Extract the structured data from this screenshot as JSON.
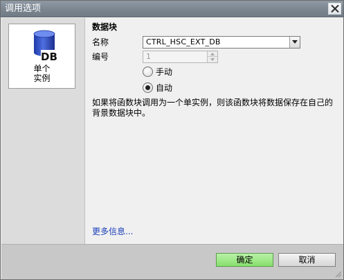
{
  "window": {
    "title": "调用选项"
  },
  "left_panel": {
    "tile_label_line1": "单个",
    "tile_label_line2": "实例",
    "icon_text": "DB"
  },
  "main": {
    "section_title": "数据块",
    "name_label": "名称",
    "name_value": "CTRL_HSC_EXT_DB",
    "number_label": "编号",
    "number_value": "1",
    "radio_manual": "手动",
    "radio_auto": "自动",
    "selected_numbering": "自动",
    "description": "如果将函数块调用为一个单实例，则该函数块将数据保存在自己的背景数据块中。",
    "more_info": "更多信息..."
  },
  "footer": {
    "ok_label": "确定",
    "cancel_label": "取消"
  },
  "colors": {
    "title_bar": "#7b8691",
    "ok_button": "#86df6c",
    "link": "#1a3fb8",
    "db_icon": "#3a57c8"
  }
}
